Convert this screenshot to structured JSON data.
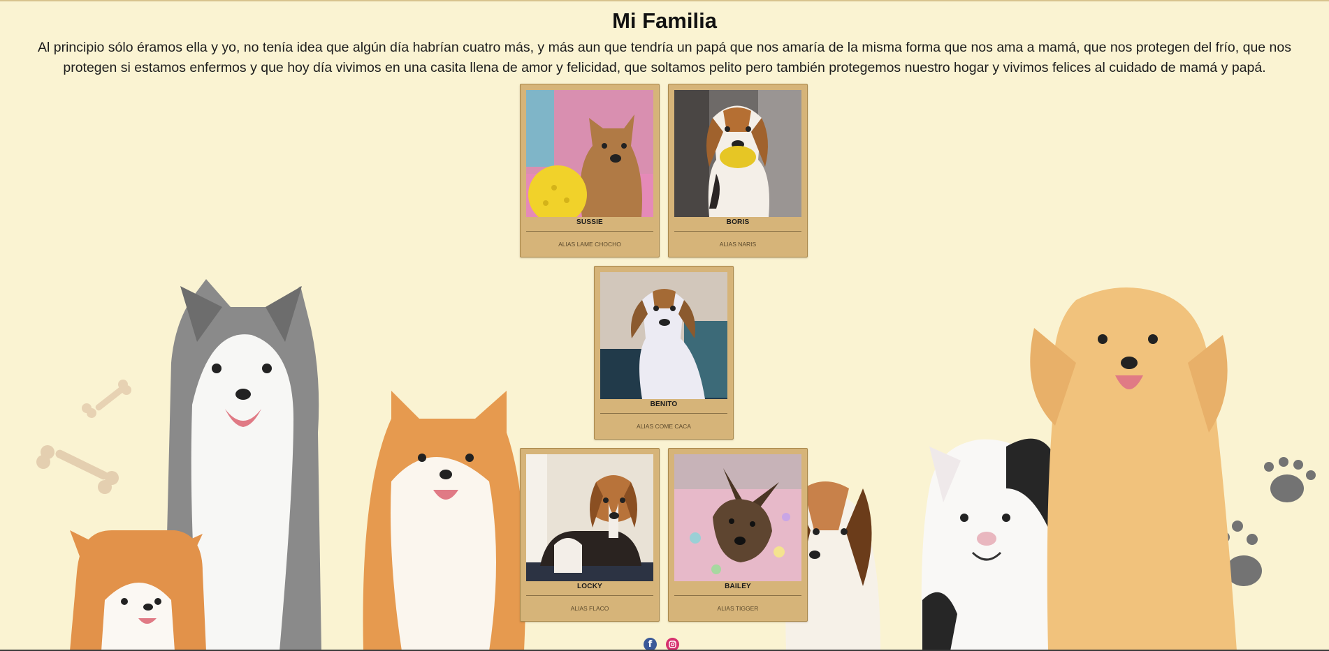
{
  "page": {
    "title": "Mi Familia",
    "intro": "Al principio sólo éramos ella y yo, no tenía idea que algún día habrían cuatro más, y más aun que tendría un papá que nos amaría de la misma forma que nos ama a mamá, que nos protegen del frío, que nos protegen si estamos enfermos y que hoy día vivimos en una casita llena de amor y felicidad, que soltamos pelito pero también protegemos nuestro hogar y vivimos felices al cuidado de mamá y papá."
  },
  "dogs": [
    {
      "name": "SUSSIE",
      "alias": "ALIAS LAME CHOCHO"
    },
    {
      "name": "BORIS",
      "alias": "ALIAS NARIS"
    },
    {
      "name": "BENITO",
      "alias": "ALIAS COME CACA"
    },
    {
      "name": "LOCKY",
      "alias": "ALIAS FLACO"
    },
    {
      "name": "BAILEY",
      "alias": "ALIAS TIGGER"
    }
  ],
  "social": [
    {
      "icon": "facebook-icon",
      "color": "#3b5998"
    },
    {
      "icon": "instagram-icon",
      "color": "#d6306e"
    }
  ],
  "theme": {
    "background": "#faf3d2",
    "card": "#d6b479",
    "card_border": "#a9884c"
  }
}
